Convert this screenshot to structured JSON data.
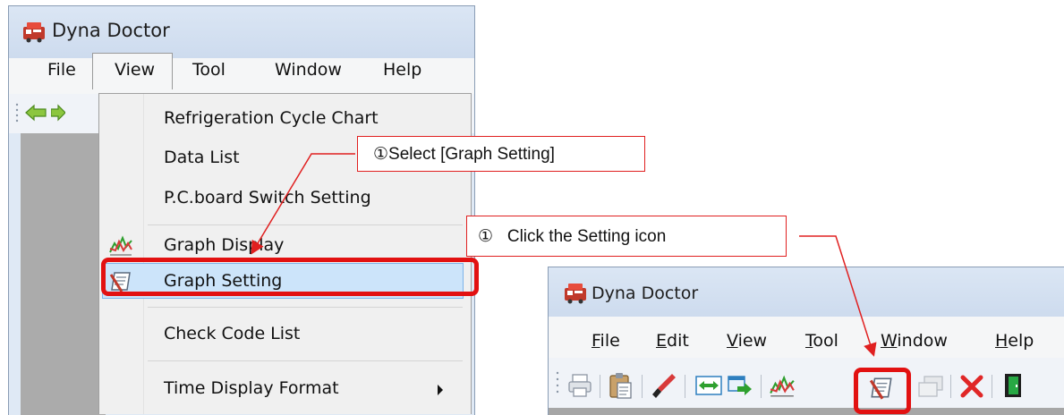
{
  "left_window": {
    "title": "Dyna Doctor",
    "menu": [
      "File",
      "View",
      "Tool",
      "Window",
      "Help"
    ],
    "dropdown": {
      "items": [
        {
          "label": "Refrigeration Cycle Chart"
        },
        {
          "label": "Data List"
        },
        {
          "label": "P.C.board Switch Setting"
        },
        {
          "label": "Graph Display",
          "icon": "graph-display-icon"
        },
        {
          "label": "Graph Setting",
          "icon": "graph-setting-icon",
          "highlighted": true
        },
        {
          "label": "Check Code List"
        },
        {
          "label": "Time Display Format",
          "submenu": true
        }
      ]
    }
  },
  "callouts": {
    "select": "①Select [Graph Setting]",
    "click": "①   Click the Setting icon"
  },
  "right_window": {
    "title": "Dyna Doctor",
    "menu": [
      {
        "label": "File",
        "accel": "F",
        "rest": "ile"
      },
      {
        "label": "Edit",
        "accel": "E",
        "rest": "dit"
      },
      {
        "label": "View",
        "accel": "V",
        "rest": "iew"
      },
      {
        "label": "Tool",
        "accel": "T",
        "rest": "ool"
      },
      {
        "label": "Window",
        "accel": "W",
        "rest": "indow"
      },
      {
        "label": "Help",
        "accel": "H",
        "rest": "elp"
      }
    ],
    "toolbar_icons": [
      "print-icon",
      "clipboard-icon",
      "flashlight-icon",
      "resize-horizontal-icon",
      "export-icon",
      "graph-display-icon",
      "graph-setting-icon",
      "windows-icon",
      "delete-icon",
      "exit-door-icon"
    ]
  },
  "colors": {
    "highlight_border": "#e21111",
    "callout_border": "#e02020",
    "menu_selection": "#cce4fa",
    "title_bar": "#d6e3f3"
  }
}
